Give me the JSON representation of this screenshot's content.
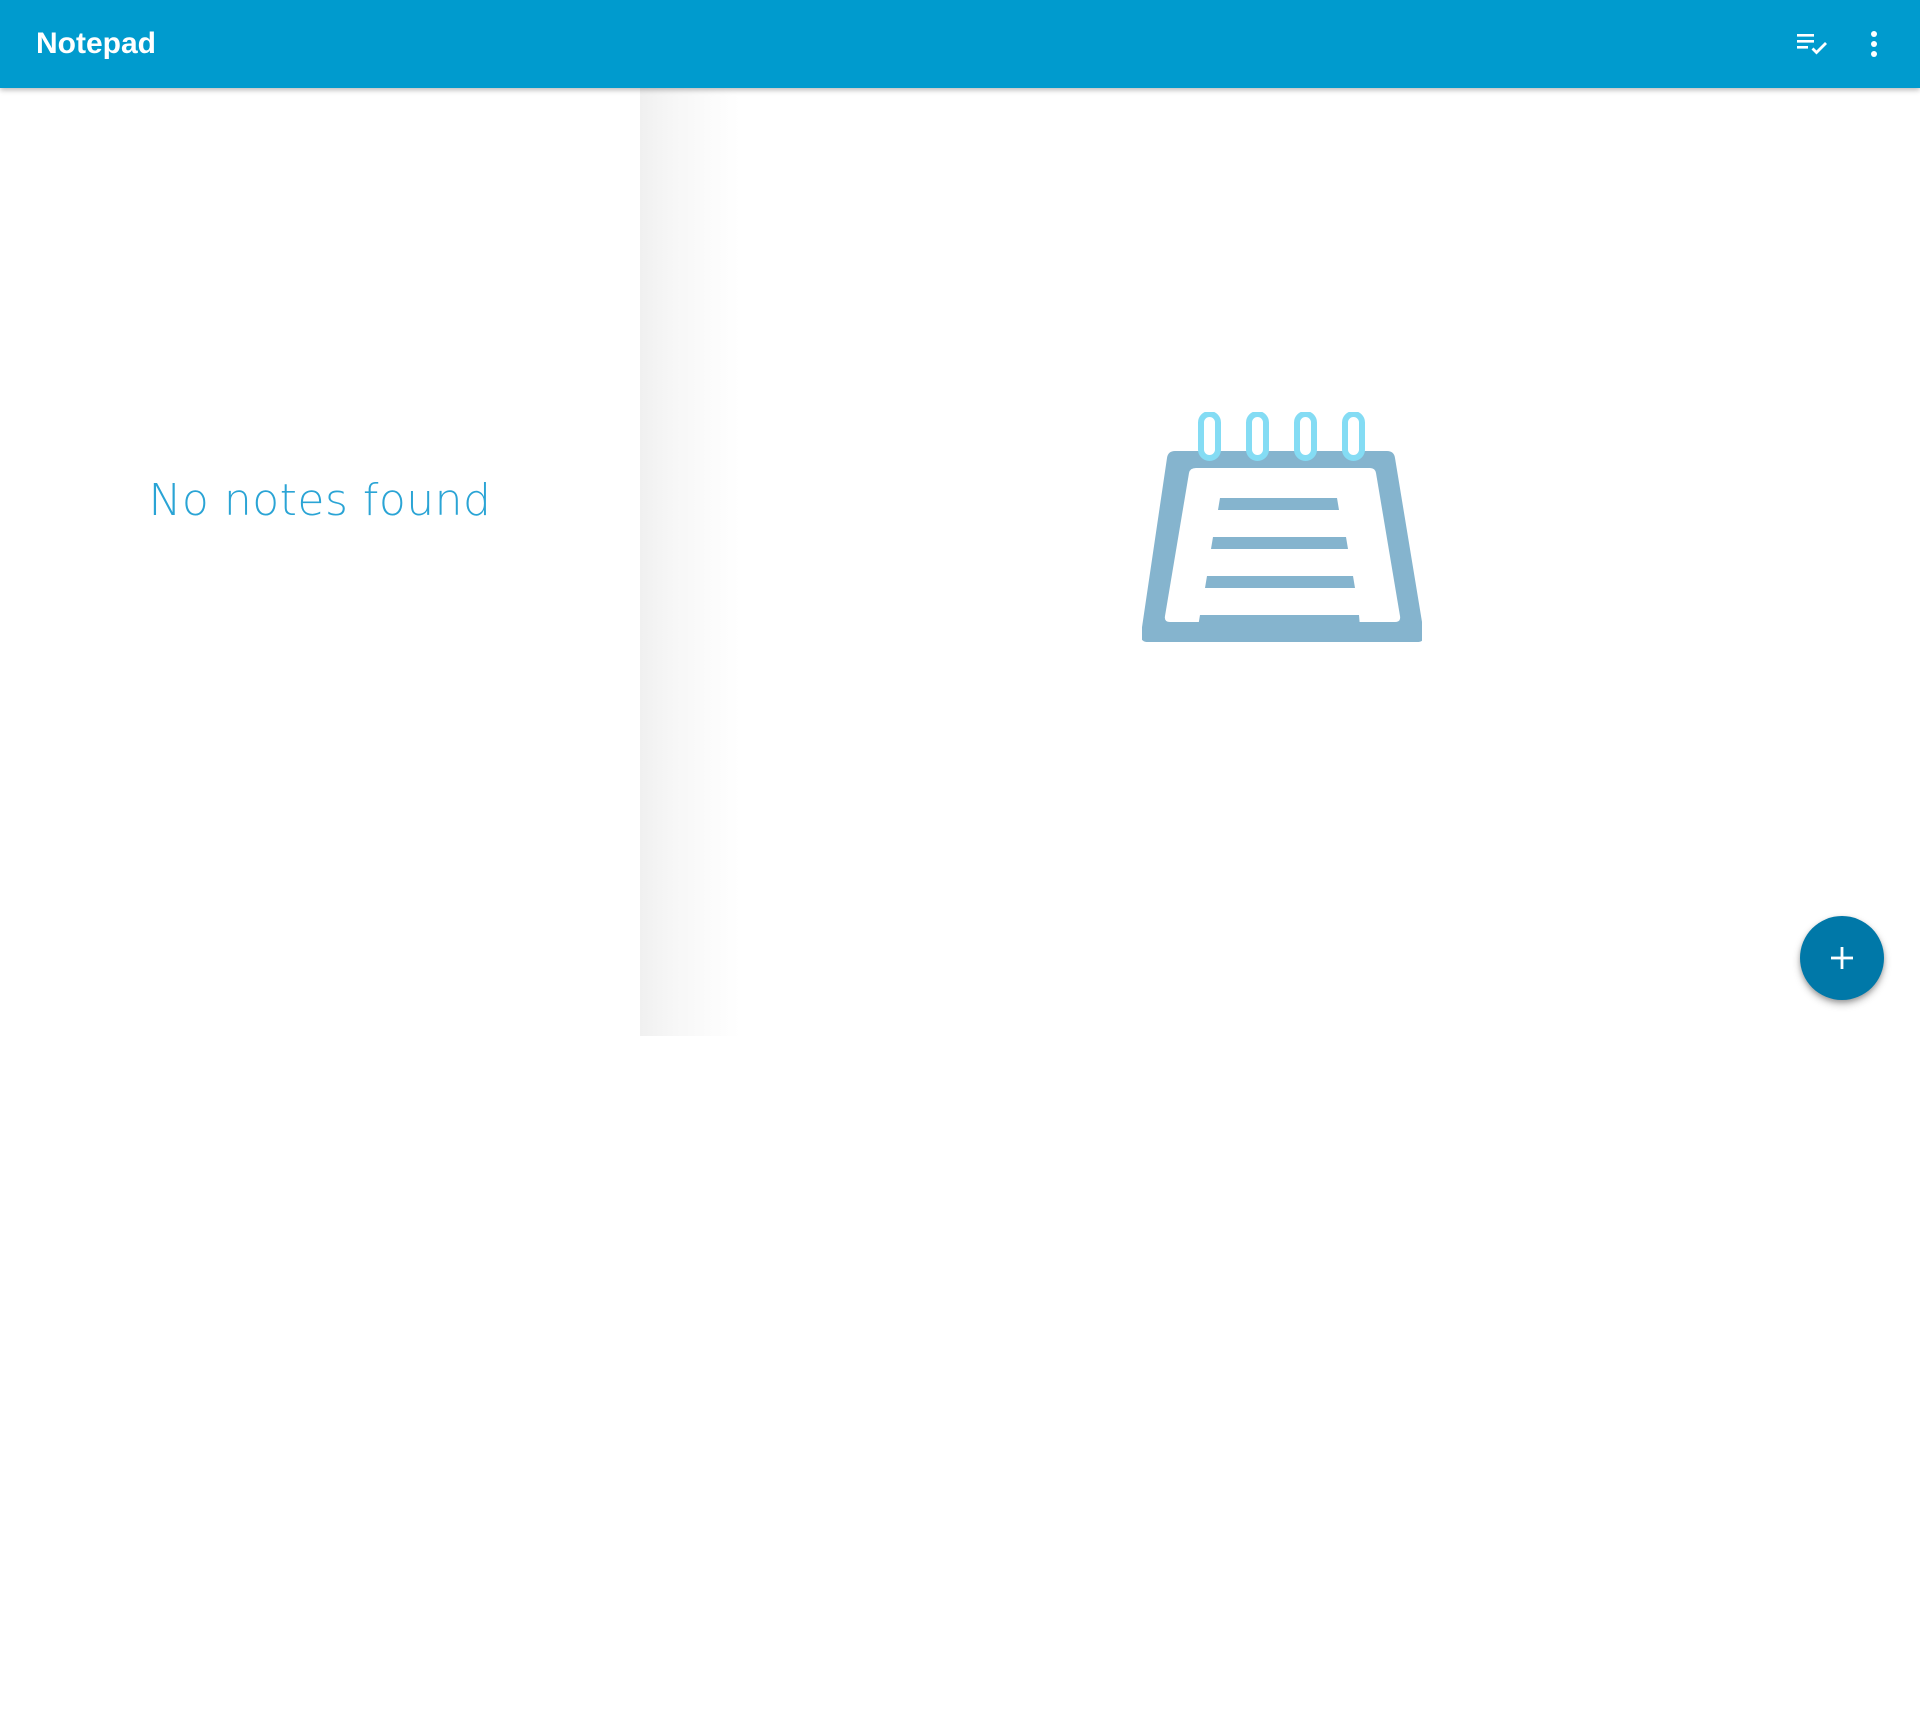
{
  "app_bar": {
    "title": "Notepad",
    "background_color": "#009bce",
    "actions": [
      {
        "icon": "playlist-check-icon",
        "label": "Select notes"
      },
      {
        "icon": "more-vert-icon",
        "label": "More options"
      }
    ]
  },
  "note_list": {
    "empty_message": "No notes found",
    "message_color": "#2aa4d5"
  },
  "detail_pane": {
    "illustration": "notepad-icon",
    "illustration_color": "#85b4ce",
    "ring_color": "#84dcf4"
  },
  "fab": {
    "icon": "plus-icon",
    "label": "New note",
    "color": "#0078a8"
  }
}
